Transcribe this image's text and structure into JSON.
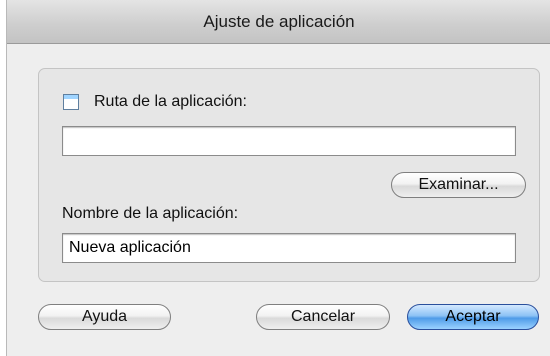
{
  "window": {
    "title": "Ajuste de aplicación"
  },
  "path": {
    "label": "Ruta de la aplicación:",
    "value": "",
    "browse_label": "Examinar..."
  },
  "name": {
    "label": "Nombre de la aplicación:",
    "value": "Nueva aplicación"
  },
  "buttons": {
    "help": "Ayuda",
    "cancel": "Cancelar",
    "ok": "Aceptar"
  },
  "colors": {
    "primary_button": "#4f9be8",
    "checkbox_accent": "#9fd4ff"
  }
}
